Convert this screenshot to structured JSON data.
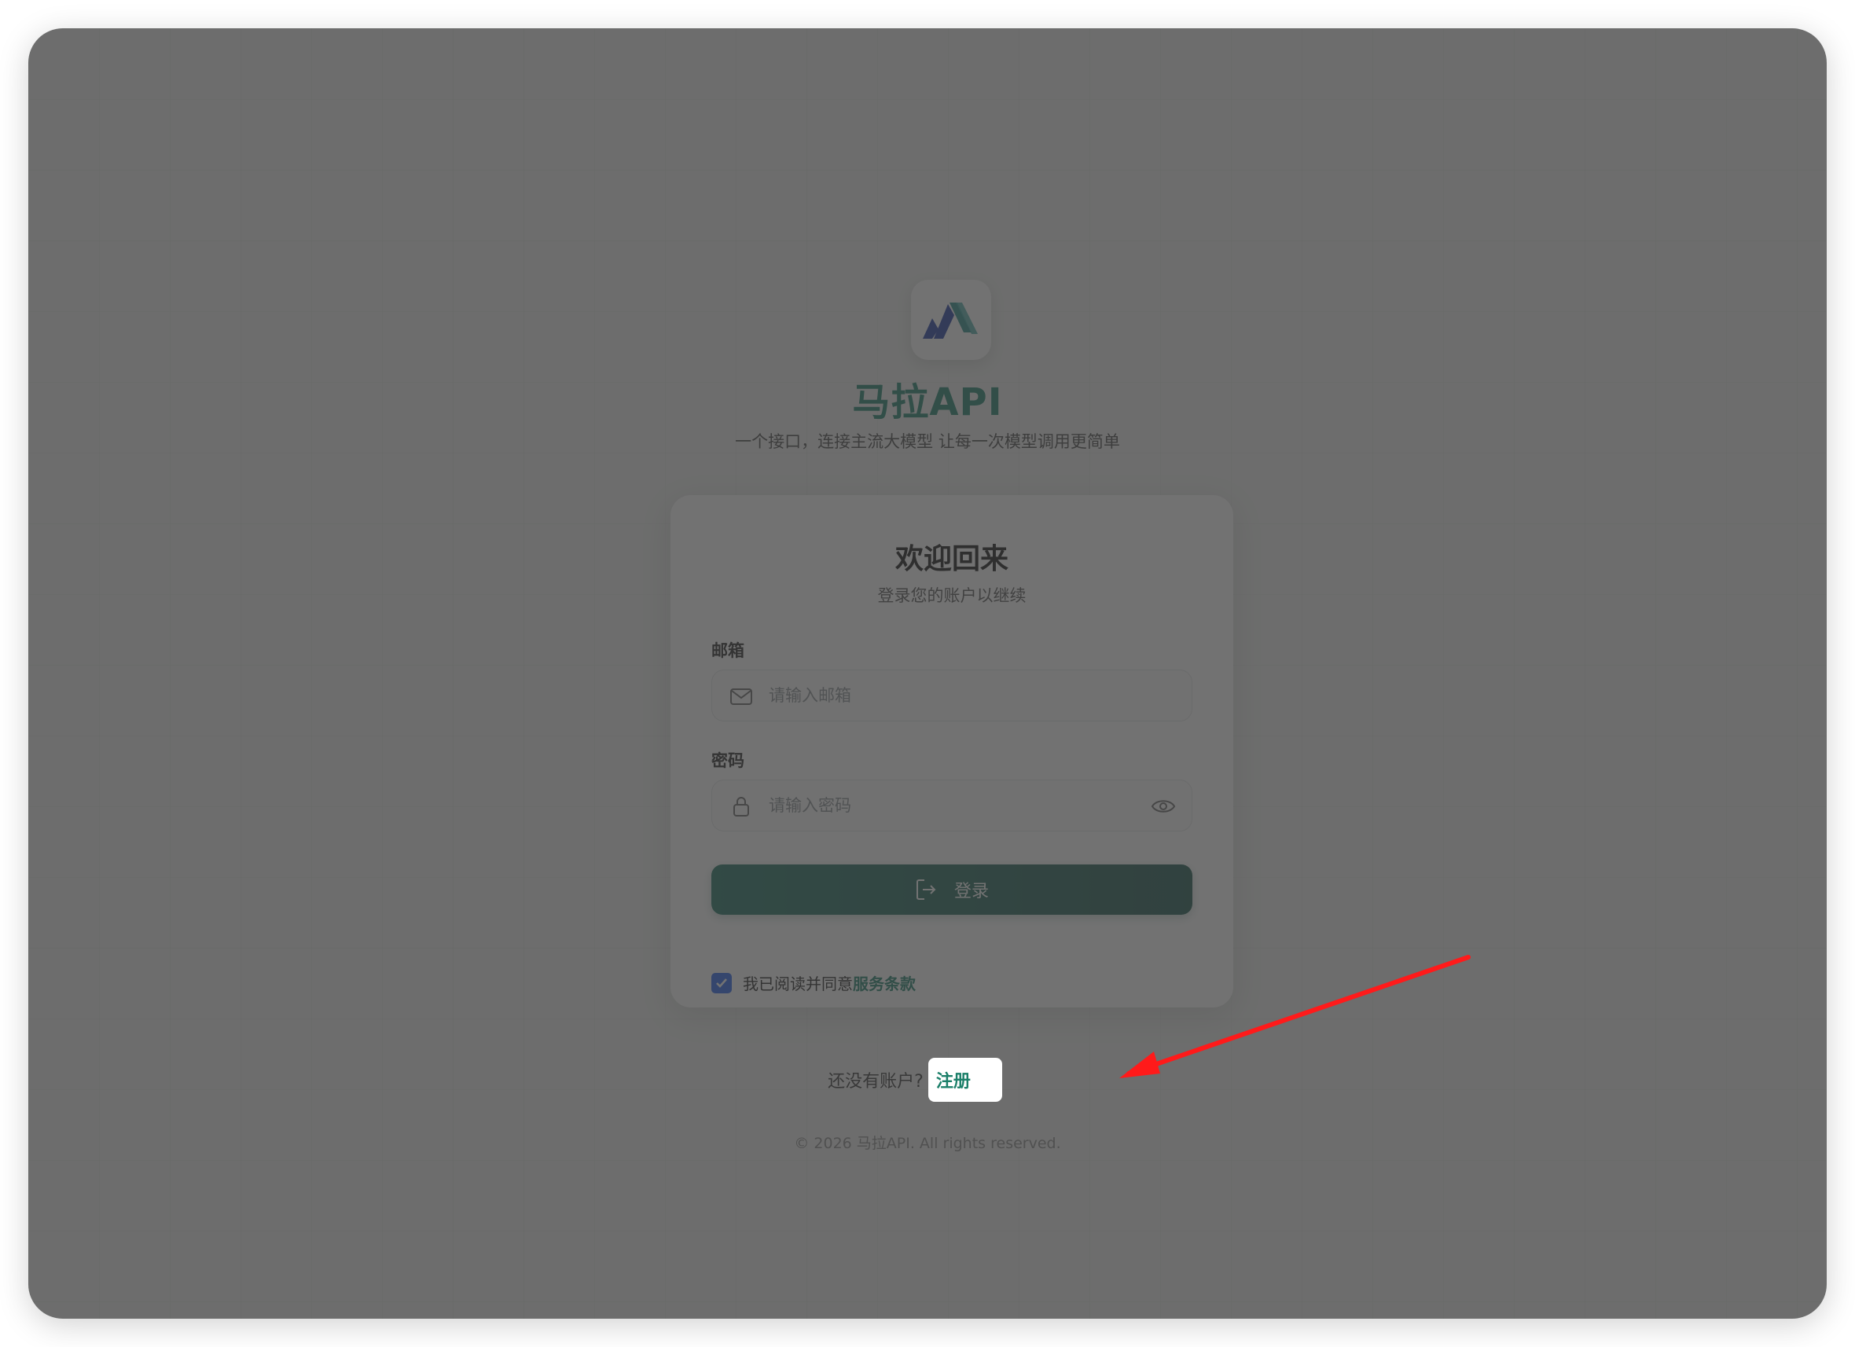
{
  "brand": {
    "name": "马拉API",
    "tagline": "一个接口，连接主流大模型 让每一次模型调用更简单",
    "logo_icon": "mountain-logo-icon"
  },
  "login_card": {
    "title": "欢迎回来",
    "subtitle": "登录您的账户以继续",
    "email": {
      "label": "邮箱",
      "placeholder": "请输入邮箱",
      "value": "",
      "icon": "mail-icon"
    },
    "password": {
      "label": "密码",
      "placeholder": "请输入密码",
      "value": "",
      "icon": "lock-icon",
      "toggle_icon": "eye-icon"
    },
    "submit": {
      "label": "登录",
      "icon": "login-icon"
    },
    "agreement": {
      "checked": true,
      "text": "我已阅读并同意",
      "link": "服务条款"
    }
  },
  "register": {
    "prompt": "还没有账户?",
    "link": "注册"
  },
  "footer": {
    "copyright": "© 2026 马拉API. All rights reserved."
  },
  "colors": {
    "brand_green": "#1b7f69",
    "button_dark_green": "#1a5e52",
    "checkbox_blue": "#2563eb",
    "annotation_red": "#ff1a1a"
  }
}
